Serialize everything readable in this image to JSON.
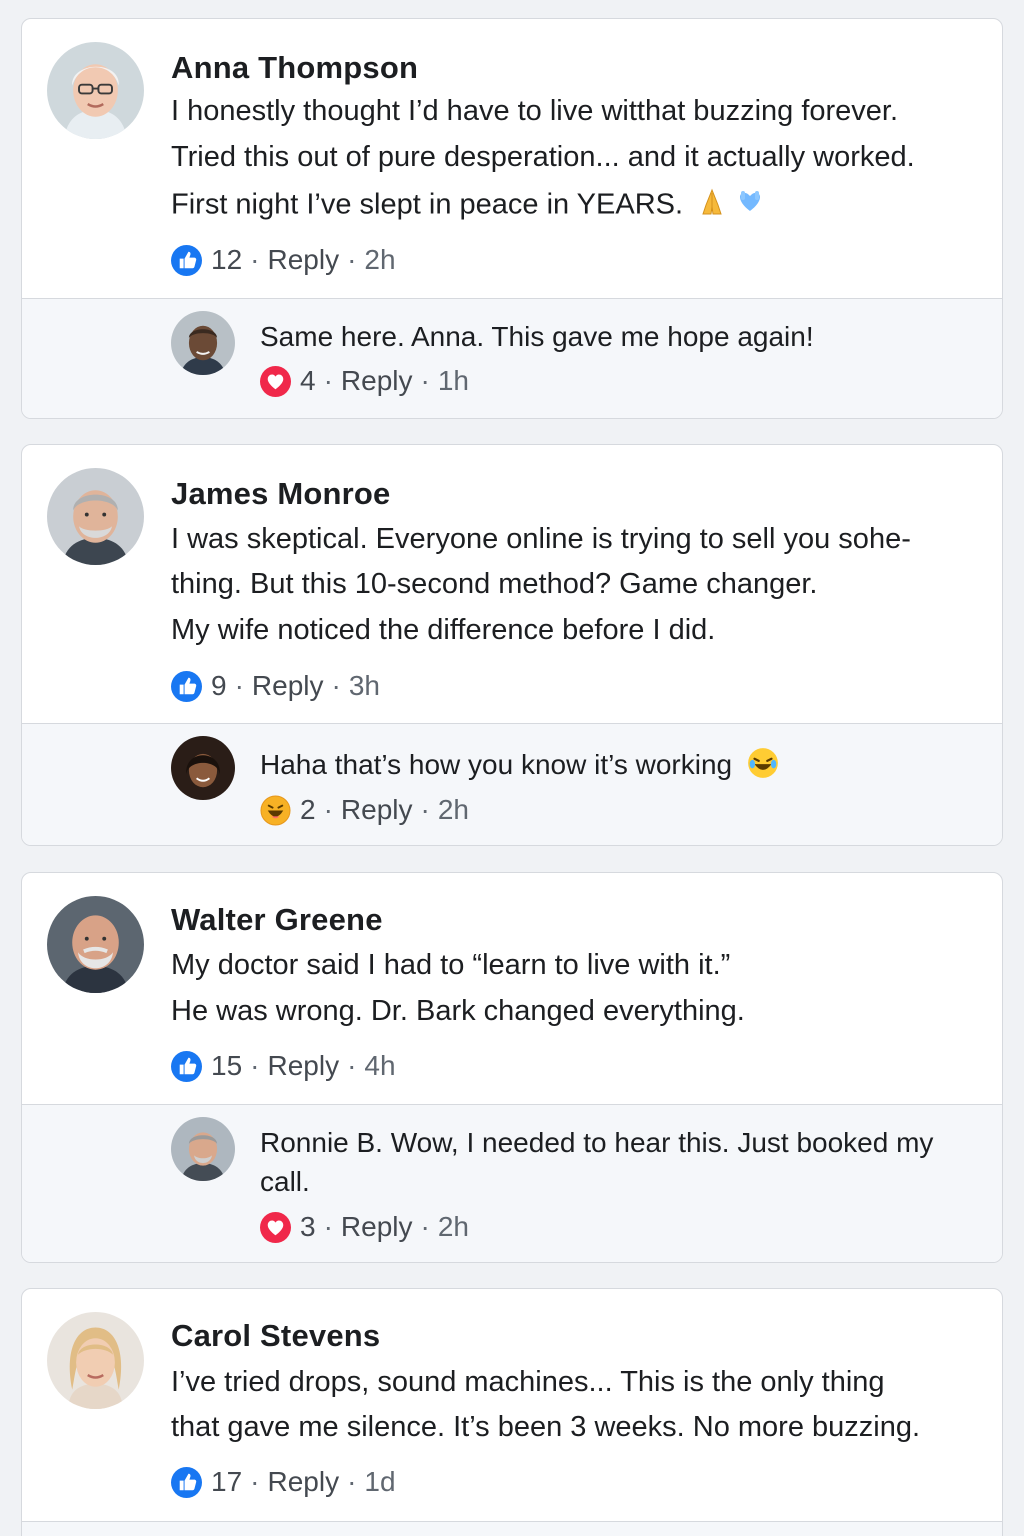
{
  "colors": {
    "page_background": "#f0f2f5",
    "card_background": "#ffffff",
    "reply_background": "#f5f7fa",
    "like_blue": "#1877f2",
    "love_red": "#f0284a",
    "meta_gray": "#606770"
  },
  "comments": [
    {
      "author": "Anna Thompson",
      "lines": [
        "I honestly thought I’d have to live witthat buzzing forever.",
        "Tried this out of pure desperation... and it actually worked.",
        "First night I’ve slept in peace in YEARS."
      ],
      "emojis": [
        "folded-hands-emoji",
        "blue-heart-hands-emoji"
      ],
      "reaction_icon": "like-icon",
      "reactions": "12",
      "reply_label": "Reply",
      "time": "2h",
      "reply": {
        "text_lines": [
          "Same here. Anna. This gave me hope again!"
        ],
        "reaction_icon": "love-icon",
        "reactions": "4",
        "reply_label": "Reply",
        "time": "1h"
      }
    },
    {
      "author": "James Monroe",
      "lines": [
        "I was skeptical. Everyone online is trying to sell you so‌he-",
        "thing. But this 10-second method? Game changer.",
        "My wife noticed the difference before I did."
      ],
      "reaction_icon": "like-icon",
      "reactions": "9",
      "reply_label": "Reply",
      "time": "3h",
      "reply": {
        "text_lines": [
          "Haha that’s how you know it’s working"
        ],
        "text_emoji": "laughing-tears-emoji",
        "reaction_icon": "laugh-icon",
        "reactions": "2",
        "reply_label": "Reply",
        "time": "2h"
      }
    },
    {
      "author": "Walter Greene",
      "lines": [
        "My doctor said I had to “learn to live with it.”",
        "He was wrong. Dr. Bark changed everything."
      ],
      "reaction_icon": "like-icon",
      "reactions": "15",
      "reply_label": "Reply",
      "time": "4h",
      "reply": {
        "text_lines": [
          "Ronnie B. Wow, I needed to hear this. Just booked my",
          "call."
        ],
        "reaction_icon": "love-icon",
        "reactions": "3",
        "reply_label": "Reply",
        "time": "2h"
      }
    },
    {
      "author": "Carol Stevens",
      "lines": [
        "I’ve tried drops, sound machines... This is the only thing",
        "that gave me silence. It’s been 3 weeks. No more buzzing."
      ],
      "reaction_icon": "like-icon",
      "reactions": "17",
      "reply_label": "Reply",
      "time": "1d"
    }
  ]
}
